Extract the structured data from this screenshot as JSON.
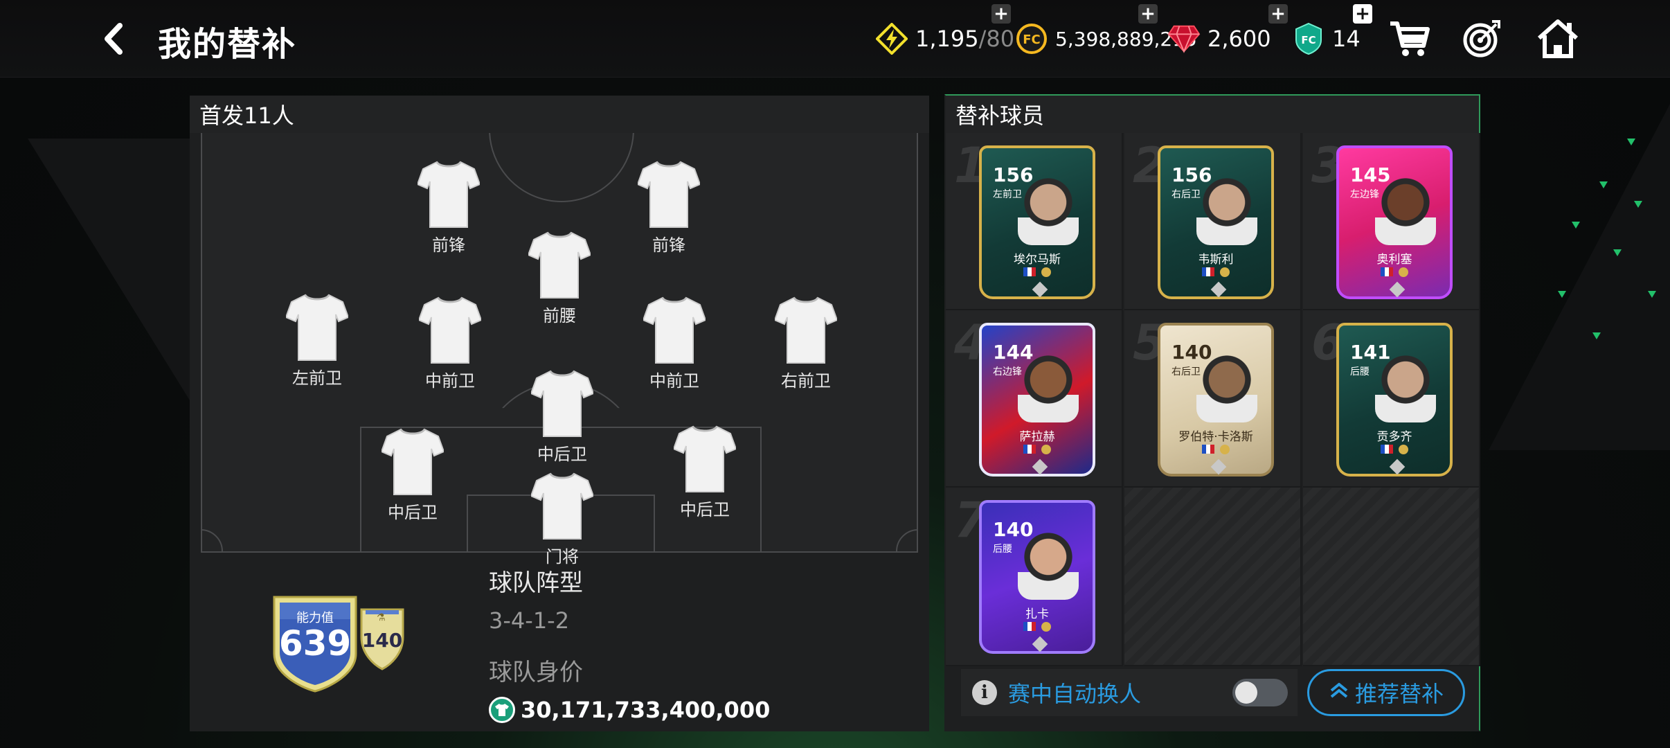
{
  "header": {
    "title": "我的替补",
    "currencies": [
      {
        "name": "energy",
        "value": "1,195",
        "max": "/80"
      },
      {
        "name": "coins",
        "value": "5,398,889,215"
      },
      {
        "name": "gems",
        "value": "2,600"
      },
      {
        "name": "fc-points",
        "value": "14"
      }
    ],
    "plus_symbol": "+"
  },
  "starters": {
    "title": "首发11人",
    "players": [
      {
        "pos": "前锋"
      },
      {
        "pos": "前锋"
      },
      {
        "pos": "前腰"
      },
      {
        "pos": "左前卫"
      },
      {
        "pos": "中前卫"
      },
      {
        "pos": "中前卫"
      },
      {
        "pos": "右前卫"
      },
      {
        "pos": "中后卫"
      },
      {
        "pos": "中后卫"
      },
      {
        "pos": "中后卫"
      },
      {
        "pos": "门将"
      }
    ],
    "overall_label": "能力值",
    "overall_value": "639",
    "boost_value": "140",
    "formation_label": "球队阵型",
    "formation": "3-4-1-2",
    "team_value_label": "球队身价",
    "team_value": "30,171,733,400,000"
  },
  "subs": {
    "title": "替补球员",
    "cards": [
      {
        "num": "1",
        "rating": "156",
        "pos": "左前卫",
        "name": "埃尔马斯",
        "theme": "teal-gold"
      },
      {
        "num": "2",
        "rating": "156",
        "pos": "右后卫",
        "name": "韦斯利",
        "theme": "teal-gold"
      },
      {
        "num": "3",
        "rating": "145",
        "pos": "左边锋",
        "name": "奥利塞",
        "theme": "pink-purple"
      },
      {
        "num": "4",
        "rating": "144",
        "pos": "右边锋",
        "name": "萨拉赫",
        "theme": "star-red-blue"
      },
      {
        "num": "5",
        "rating": "140",
        "pos": "右后卫",
        "name": "罗伯特·卡洛斯",
        "theme": "icon-cream"
      },
      {
        "num": "6",
        "rating": "141",
        "pos": "后腰",
        "name": "贡多齐",
        "theme": "teal-gold"
      },
      {
        "num": "7",
        "rating": "140",
        "pos": "后腰",
        "name": "扎卡",
        "theme": "purple"
      }
    ],
    "auto_sub_label": "赛中自动换人",
    "auto_sub_on": false,
    "recommend_label": "推荐替补",
    "info_symbol": "i"
  },
  "colors": {
    "accent_blue": "#2a9be0",
    "accent_green": "#2f9a5a",
    "panel_bg": "#1e1f20"
  }
}
